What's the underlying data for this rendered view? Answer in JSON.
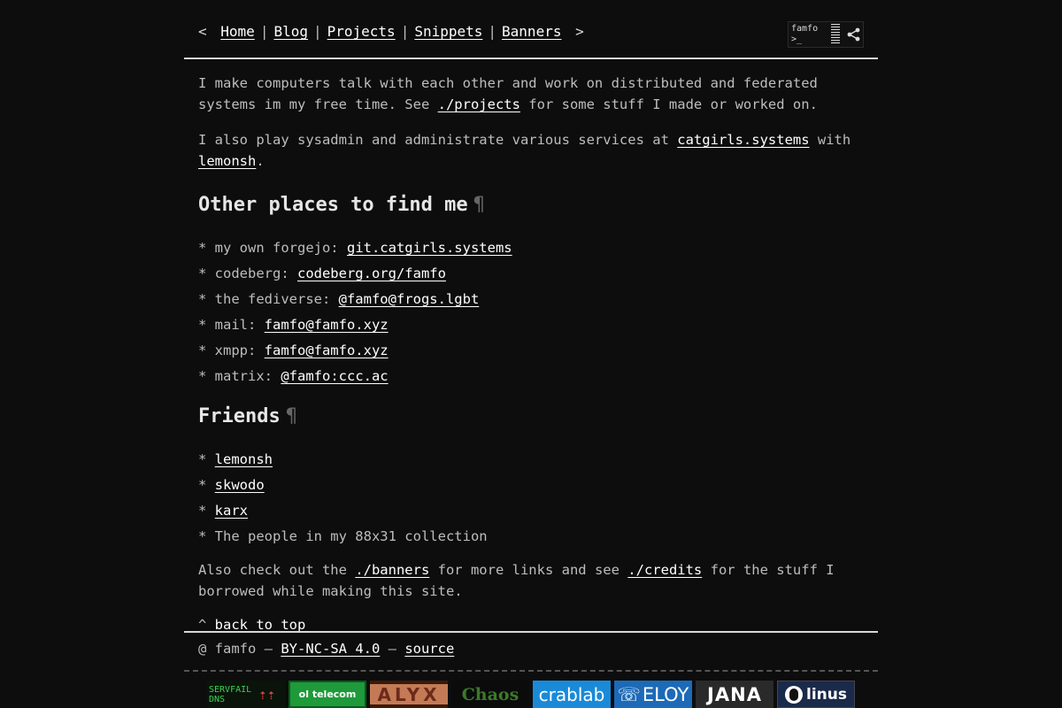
{
  "nav": {
    "open_bracket": "<",
    "close_bracket": ">",
    "separator": "|",
    "items": [
      {
        "label": "Home"
      },
      {
        "label": "Blog"
      },
      {
        "label": "Projects"
      },
      {
        "label": "Snippets"
      },
      {
        "label": "Banners"
      }
    ],
    "badge": {
      "line1": "famfo",
      "line2": ">_",
      "icon": "share-icon"
    }
  },
  "intro": {
    "p1_before": "I make computers talk with each other and work on distributed and federated systems im my free time. See ",
    "p1_link": "./projects",
    "p1_after": " for some stuff I made or worked on.",
    "p2_before": "I also play sysadmin and administrate various services at ",
    "p2_link1": "catgirls.systems",
    "p2_mid": " with ",
    "p2_link2": "lemonsh",
    "p2_after": "."
  },
  "places": {
    "heading": "Other places to find me",
    "pilcrow": "¶",
    "items": [
      {
        "prefix": "* my own forgejo: ",
        "link": "git.catgirls.systems"
      },
      {
        "prefix": "* codeberg: ",
        "link": "codeberg.org/famfo"
      },
      {
        "prefix": "* the fediverse: ",
        "link": "@famfo@frogs.lgbt"
      },
      {
        "prefix": "* mail: ",
        "link": "famfo@famfo.xyz"
      },
      {
        "prefix": "* xmpp: ",
        "link": "famfo@famfo.xyz"
      },
      {
        "prefix": "* matrix: ",
        "link": "@famfo:ccc.ac"
      }
    ]
  },
  "friends": {
    "heading": "Friends",
    "pilcrow": "¶",
    "items": [
      {
        "prefix": "* ",
        "link": "lemonsh"
      },
      {
        "prefix": "* ",
        "link": "skwodo"
      },
      {
        "prefix": "* ",
        "link": "karx"
      }
    ],
    "plain_item": "* The people in my 88x31 collection"
  },
  "outro": {
    "before": "Also check out the ",
    "link1": "./banners",
    "mid": " for more links and see ",
    "link2": "./credits",
    "after": " for the stuff I borrowed while making this site."
  },
  "back_to_top": {
    "prefix": "^ ",
    "link": "back to top"
  },
  "footer": {
    "prefix": "@ famfo – ",
    "license": "BY-NC-SA 4.0",
    "dash": " – ",
    "source": "source"
  },
  "banners": [
    {
      "text": "SERVFAIL DNS",
      "bg": "#0a140a",
      "fg": "#39d353"
    },
    {
      "text": "ol telecom",
      "bg": "#1e9a3a",
      "fg": "#ffffff"
    },
    {
      "text": "ALYX",
      "bg": "#c47a55",
      "fg": "#6b2b1a"
    },
    {
      "text": "Chaos",
      "bg": "#0b0b0b",
      "fg": "#3a7a2a"
    },
    {
      "text": "crablab",
      "bg": "#1a8ad8",
      "fg": "#ffffff"
    },
    {
      "text": "ELOY",
      "bg": "#1c6ab8",
      "fg": "#ffffff"
    },
    {
      "text": "JANA",
      "bg": "#2a2a2a",
      "fg": "#ffffff"
    },
    {
      "text": "linus",
      "bg": "#1a2a4a",
      "fg": "#ffffff"
    }
  ]
}
